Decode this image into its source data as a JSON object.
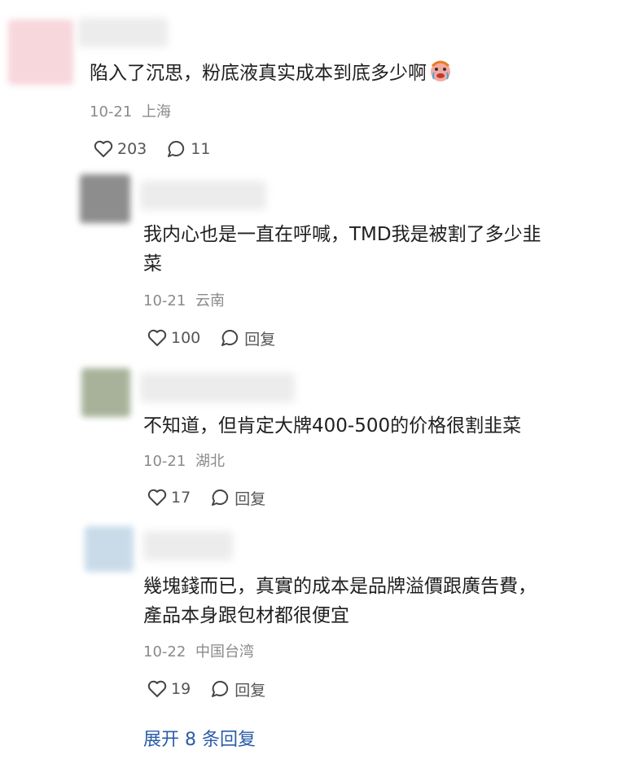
{
  "comments": [
    {
      "text": "陷入了沉思，粉底液真实成本到底多少啊",
      "emoji": "crying-clown-emoji",
      "date": "10-21",
      "location": "上海",
      "likes": "203",
      "replies": "11"
    }
  ],
  "replies": [
    {
      "text": "我内心也是一直在呼喊，TMD我是被割了多少韭\n菜",
      "date": "10-21",
      "location": "云南",
      "likes": "100",
      "reply_label": "回复"
    },
    {
      "text": "不知道，但肯定大牌400-500的价格很割韭菜",
      "date": "10-21",
      "location": "湖北",
      "likes": "17",
      "reply_label": "回复"
    },
    {
      "text": "幾塊錢而已，真實的成本是品牌溢價跟廣告費，\n產品本身跟包材都很便宜",
      "date": "10-22",
      "location": "中国台湾",
      "likes": "19",
      "reply_label": "回复"
    }
  ],
  "expand_label": "展开 8 条回复",
  "colors": {
    "link": "#2b5ca8",
    "meta": "#8a8a8a",
    "text": "#1f1f1f"
  }
}
